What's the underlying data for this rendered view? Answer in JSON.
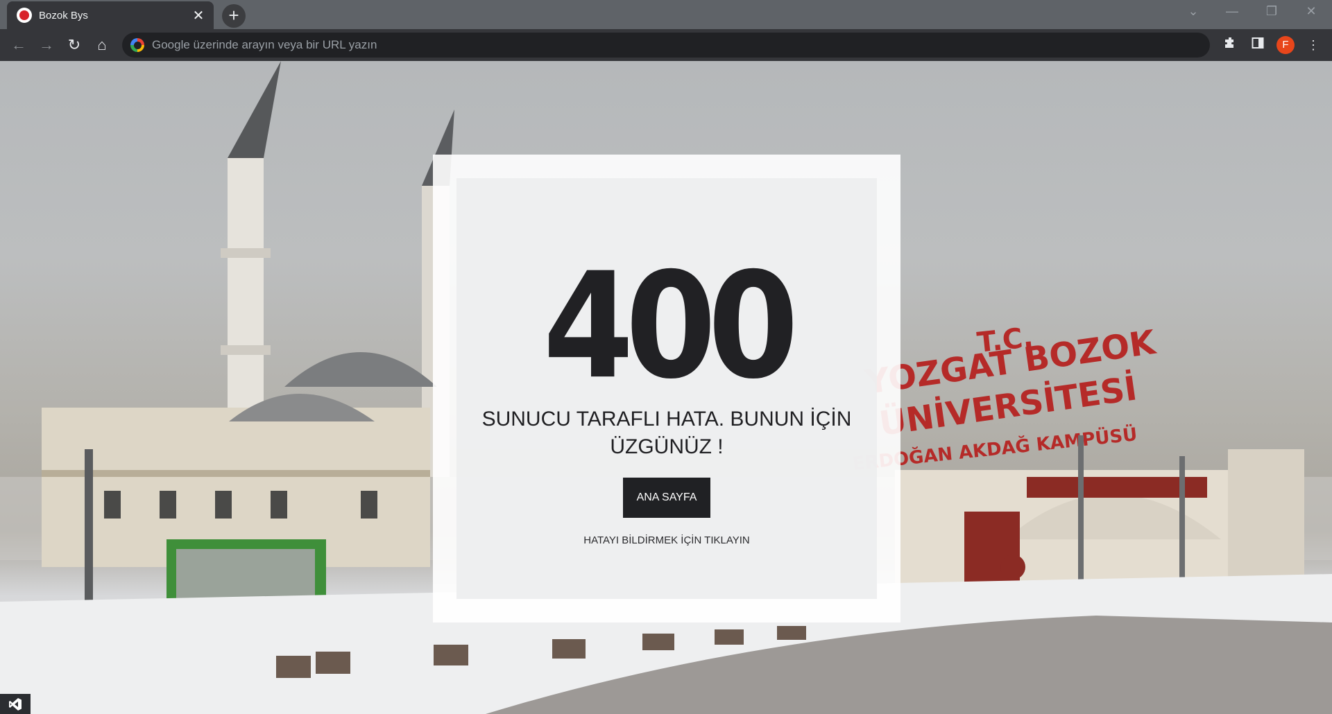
{
  "browser": {
    "tab": {
      "title": "Bozok Bys",
      "close": "✕"
    },
    "new_tab": "+",
    "window": {
      "dropdown": "⌄",
      "minimize": "—",
      "restore": "❐",
      "close": "✕"
    },
    "nav": {
      "back": "←",
      "forward": "→",
      "reload": "↻",
      "home": "⌂"
    },
    "omnibox": {
      "placeholder": "Google üzerinde arayın veya bir URL yazın"
    },
    "icons": {
      "extensions": "extensions-icon",
      "side_panel": "side-panel-icon",
      "menu": "⋮"
    },
    "profile": {
      "initial": "F",
      "color": "#e8461b"
    }
  },
  "page": {
    "background": {
      "sign_lines": [
        "T.C.",
        "YOZGAT BOZOK",
        "ÜNİVERSİTESİ",
        "ERDOĞAN AKDAĞ KAMPÜSÜ"
      ]
    },
    "error": {
      "code": "400",
      "message": "SUNUCU TARAFLI HATA. BUNUN İÇİN ÜZGÜNÜZ !",
      "home_button": "ANA SAYFA",
      "report_link": "HATAYI BİLDİRMEK İÇİN TIKLAYIN"
    }
  },
  "taskbar": {
    "icon": "visual-studio-icon"
  }
}
